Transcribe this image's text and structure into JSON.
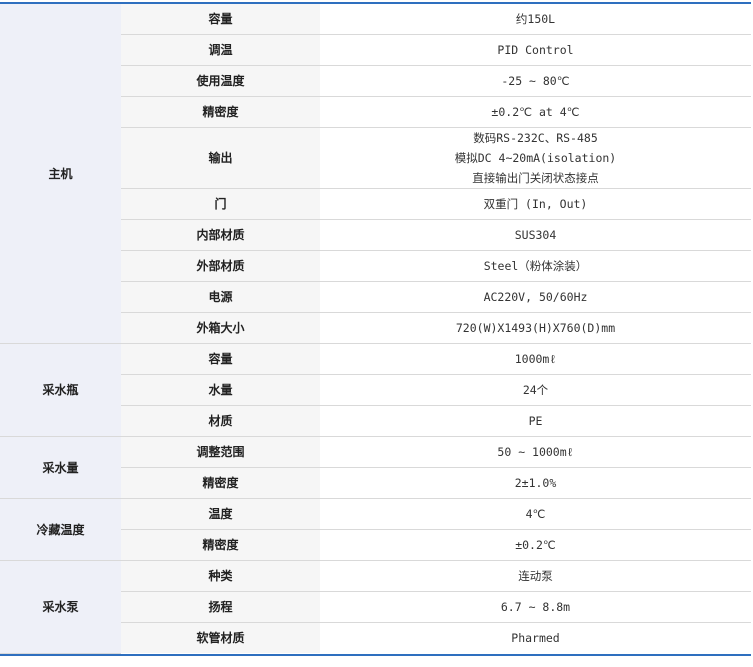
{
  "groups": {
    "main": "主机",
    "bottle": "采水瓶",
    "volume": "采水量",
    "cold": "冷藏温度",
    "pump": "采水泵"
  },
  "rows": [
    {
      "label": "容量",
      "value": "约150L"
    },
    {
      "label": "调温",
      "value": "PID Control"
    },
    {
      "label": "使用温度",
      "value": "-25 ~ 80℃"
    },
    {
      "label": "精密度",
      "value": "±0.2℃ at 4℃"
    },
    {
      "label": "输出",
      "lines": [
        "数码RS-232C、RS-485",
        "模拟DC 4~20mA(isolation)",
        "直接输出门关闭状态接点"
      ]
    },
    {
      "label": "门",
      "value": "双重门 (In, Out)"
    },
    {
      "label": "内部材质",
      "value": "SUS304"
    },
    {
      "label": "外部材质",
      "value": "Steel（粉体涂装）"
    },
    {
      "label": "电源",
      "value": "AC220V, 50/60Hz"
    },
    {
      "label": "外箱大小",
      "value": "720(W)X1493(H)X760(D)mm"
    },
    {
      "label": "容量",
      "value": "1000mℓ"
    },
    {
      "label": "水量",
      "value": "24个"
    },
    {
      "label": "材质",
      "value": "PE"
    },
    {
      "label": "调整范围",
      "value": "50 ~ 1000mℓ"
    },
    {
      "label": "精密度",
      "value": "2±1.0%"
    },
    {
      "label": "温度",
      "value": "4℃"
    },
    {
      "label": "精密度",
      "value": "±0.2℃"
    },
    {
      "label": "种类",
      "value": "连动泵"
    },
    {
      "label": "扬程",
      "value": "6.7 ~ 8.8m"
    },
    {
      "label": "软管材质",
      "value": "Pharmed"
    }
  ]
}
